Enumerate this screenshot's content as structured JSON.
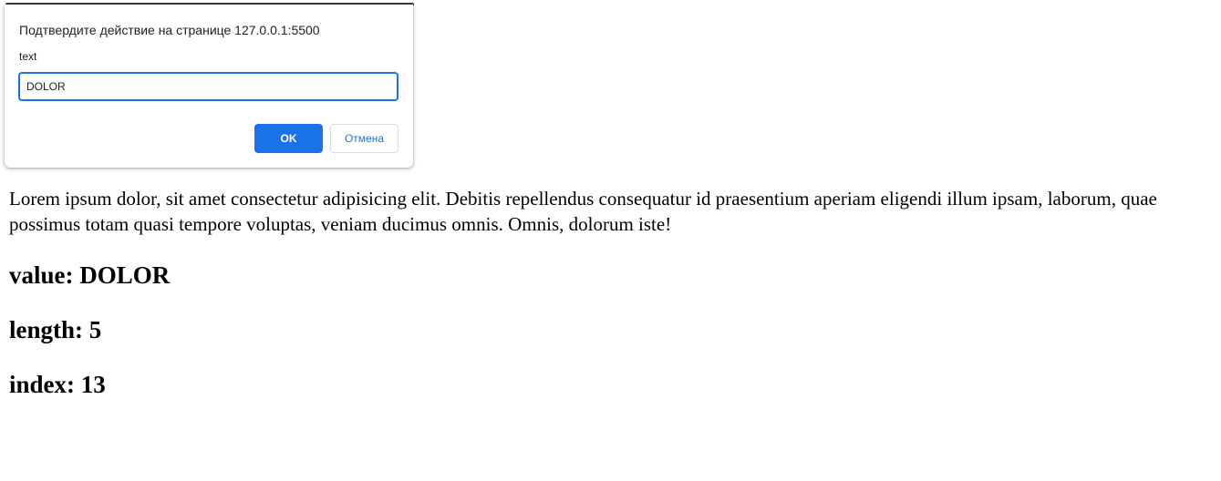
{
  "dialog": {
    "title": "Подтвердите действие на странице 127.0.0.1:5500",
    "message": "text",
    "input_value": "DOLOR",
    "ok_label": "OK",
    "cancel_label": "Отмена"
  },
  "page": {
    "paragraph": "Lorem ipsum dolor, sit amet consectetur adipisicing elit. Debitis repellendus consequatur id praesentium aperiam eligendi illum ipsam, laborum, quae possimus totam quasi tempore voluptas, veniam ducimus omnis. Omnis, dolorum iste!",
    "value_line": "value: DOLOR",
    "length_line": "length: 5",
    "index_line": "index: 13"
  },
  "colors": {
    "accent": "#1a73e8",
    "dialog_text": "#202124"
  }
}
